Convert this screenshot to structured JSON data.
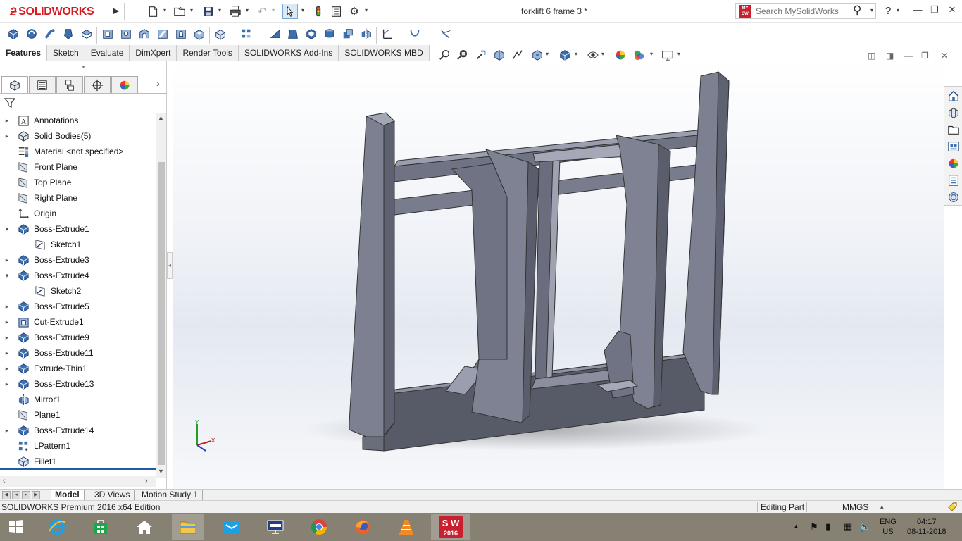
{
  "app": {
    "brand": "SOLIDWORKS",
    "document_title": "forklift 6 frame 3 *",
    "search_placeholder": "Search MySolidWorks",
    "search_badge": "MY SW",
    "help_label": "?"
  },
  "command_tabs": [
    {
      "label": "Features",
      "active": true
    },
    {
      "label": "Sketch"
    },
    {
      "label": "Evaluate"
    },
    {
      "label": "DimXpert"
    },
    {
      "label": "Render Tools"
    },
    {
      "label": "SOLIDWORKS Add-Ins"
    },
    {
      "label": "SOLIDWORKS MBD"
    }
  ],
  "feature_tree": {
    "items": [
      {
        "label": "Annotations",
        "icon": "annotations-icon",
        "expandable": true
      },
      {
        "label": "Solid Bodies(5)",
        "icon": "solid-bodies-icon",
        "expandable": true
      },
      {
        "label": "Material <not specified>",
        "icon": "material-icon",
        "expandable": false
      },
      {
        "label": "Front Plane",
        "icon": "plane-icon",
        "expandable": false
      },
      {
        "label": "Top Plane",
        "icon": "plane-icon",
        "expandable": false
      },
      {
        "label": "Right Plane",
        "icon": "plane-icon",
        "expandable": false
      },
      {
        "label": "Origin",
        "icon": "origin-icon",
        "expandable": false
      },
      {
        "label": "Boss-Extrude1",
        "icon": "extrude-icon",
        "expandable": true,
        "expanded": true
      },
      {
        "label": "Sketch1",
        "icon": "sketch-icon",
        "child": true
      },
      {
        "label": "Boss-Extrude3",
        "icon": "extrude-icon",
        "expandable": true
      },
      {
        "label": "Boss-Extrude4",
        "icon": "extrude-icon",
        "expandable": true,
        "expanded": true
      },
      {
        "label": "Sketch2",
        "icon": "sketch-icon",
        "child": true
      },
      {
        "label": "Boss-Extrude5",
        "icon": "extrude-icon",
        "expandable": true
      },
      {
        "label": "Cut-Extrude1",
        "icon": "cut-extrude-icon",
        "expandable": true
      },
      {
        "label": "Boss-Extrude9",
        "icon": "extrude-icon",
        "expandable": true
      },
      {
        "label": "Boss-Extrude11",
        "icon": "extrude-icon",
        "expandable": true
      },
      {
        "label": "Extrude-Thin1",
        "icon": "extrude-icon",
        "expandable": true
      },
      {
        "label": "Boss-Extrude13",
        "icon": "extrude-icon",
        "expandable": true
      },
      {
        "label": "Mirror1",
        "icon": "mirror-icon",
        "expandable": false
      },
      {
        "label": "Plane1",
        "icon": "plane-icon",
        "expandable": false
      },
      {
        "label": "Boss-Extrude14",
        "icon": "extrude-icon",
        "expandable": true
      },
      {
        "label": "LPattern1",
        "icon": "linear-pattern-icon",
        "expandable": false
      },
      {
        "label": "Fillet1",
        "icon": "fillet-icon",
        "expandable": false
      }
    ]
  },
  "bottom_tabs": [
    {
      "label": "Model",
      "active": true
    },
    {
      "label": "3D Views"
    },
    {
      "label": "Motion Study 1"
    }
  ],
  "status": {
    "edition": "SOLIDWORKS Premium 2016 x64 Edition",
    "mode": "Editing Part",
    "units": "MMGS"
  },
  "triad": {
    "y_label": "Y",
    "x_label": "X"
  },
  "taskbar": {
    "lang_line1": "ENG",
    "lang_line2": "US",
    "time": "04:17",
    "date": "08-11-2018",
    "sw_badge": "S W",
    "sw_year": "2016"
  },
  "colors": {
    "brand_red": "#d71920",
    "model_face": "#7f8394",
    "model_dark": "#575a67",
    "taskbar": "#878174",
    "tree_selection": "#1e5aa8"
  }
}
